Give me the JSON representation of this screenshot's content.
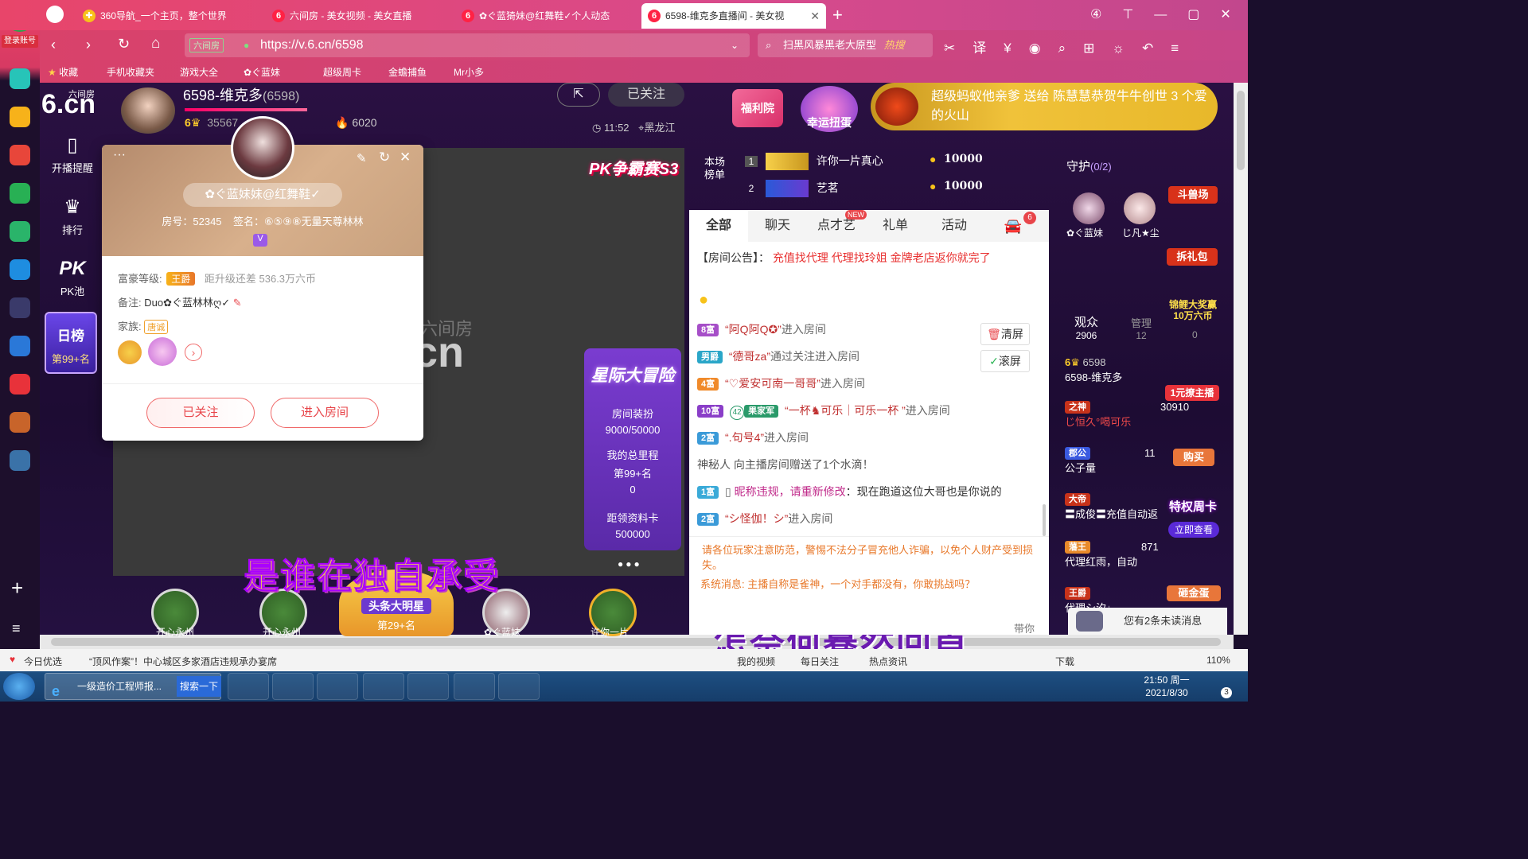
{
  "browser": {
    "login_label": "登录账号",
    "tabs": [
      {
        "label": "360导航_一个主页，整个世界"
      },
      {
        "label": "六间房 - 美女视频 - 美女直播"
      },
      {
        "label": "✿ぐ蓝猗妹@红舞鞋✓个人动态"
      },
      {
        "label": "6598-维克多直播间 - 美女视"
      }
    ],
    "address": "https://v.6.cn/6598",
    "address_badge": "六间房",
    "search_placeholder": "扫黑风暴黑老大原型",
    "search_hot": "热搜",
    "bookmarks": [
      "收藏",
      "手机收藏夹",
      "游戏大全",
      "✿ぐ蓝妹",
      "超级周卡",
      "金蟾捕鱼",
      "Mr小多"
    ]
  },
  "sidebar": {
    "items": [
      "开播提醒",
      "排行",
      "PK池"
    ],
    "day_rank": "日榜",
    "day_rank_pos": "第99+名"
  },
  "header": {
    "logo": "6.cn",
    "logo_sub": "六间房",
    "host_name": "6598-维克多",
    "host_id": "(6598)",
    "host_level": "6",
    "fans_count": "35567",
    "fire_count": "6020",
    "follow_label": "已关注",
    "time": "11:52",
    "location": "黑龙江",
    "welfare": "福利院",
    "lucky": "幸运扭蛋",
    "banner_text": "超级蚂蚁他亲爹 送给 陈慧慧恭贺牛牛创世 3 个爱的火山"
  },
  "popup": {
    "name": "✿ぐ蓝妹妹@红舞鞋✓",
    "room_label": "房号：52345",
    "sign_label": "签名：⑥⑤⑨⑧无量天尊林林",
    "wealth_label": "富豪等级:",
    "wealth_badge": "王爵",
    "wealth_next": "距升级还差 536.3万六币",
    "remark_label": "备注:",
    "remark_value": "Duo✿ぐ蓝林林ღ✓",
    "family_label": "家族:",
    "family_badge": "唐诚",
    "followed_button": "已关注",
    "enter_button": "进入房间"
  },
  "video": {
    "pk_title": "PK争霸赛S3",
    "subtitle_left": "是谁在独自承受",
    "subtitle_right": "怎奈何蓦然回首",
    "watermark": "六间房",
    "watermark_2": "cn"
  },
  "pk_panel": {
    "title": "星际大冒险",
    "decor_label": "房间装扮",
    "decor_value": "9000/50000",
    "mileage_label": "我的总里程",
    "mileage_rank": "第99+名",
    "mileage_value": "0",
    "card_label": "距领资料卡",
    "card_value": "500000"
  },
  "gifts": {
    "names": [
      "开心永州",
      "开心永州",
      "✿ぐ蓝妹",
      "许你一片"
    ],
    "star_title": "头条大明星",
    "star_rank": "第29+名"
  },
  "rank": {
    "label": "本场榜单",
    "rows": [
      {
        "pos": "1",
        "name": "许你一片真心",
        "coins": "10000"
      },
      {
        "pos": "2",
        "name": "艺茗",
        "coins": "10000"
      }
    ]
  },
  "chat": {
    "tabs": [
      "全部",
      "聊天",
      "点才艺",
      "礼单",
      "活动"
    ],
    "tab_new": "NEW",
    "car_count": "6",
    "notice_label": "【房间公告】：",
    "notice_text": "充值找代理 代理找玲姐 金牌老店返你就完了",
    "clear_btn": "清屏",
    "scroll_btn": "滚屏",
    "messages": [
      {
        "badge": "8富",
        "color": "#a64ec8",
        "text_user": "“阿Q阿Q✪”",
        "text": "进入房间"
      },
      {
        "badge": "男爵",
        "color": "#2aa6c8",
        "text_user": "“德哥za”",
        "text": "通过关注进入房间"
      },
      {
        "badge": "4富",
        "color": "#f08a2a",
        "text_user": "“♡爱安可南一哥哥”",
        "text": "进入房间"
      },
      {
        "badge": "10富",
        "color": "#8a3ec8",
        "text_user": "“一杯♞可乐｜可乐一杯 ”",
        "text": "进入房间"
      },
      {
        "badge": "2富",
        "color": "#3a9ad8",
        "text_user": "“.句号4”",
        "text": "进入房间"
      },
      {
        "badge": "",
        "color": "",
        "text_user": "",
        "text": "神秘人 向主播房间赠送了1个水滴！"
      },
      {
        "badge": "1富",
        "color": "#3aaad8",
        "text_user": "昵称违规，请重新修改",
        "text": "：现在跑道这位大哥也是你说的"
      },
      {
        "badge": "2富",
        "color": "#3a9ad8",
        "text_user": "“シ怪伽！シ”",
        "text": "进入房间"
      }
    ],
    "family_badge": "果家军",
    "family_level": "42",
    "warning": "请各位玩家注意防范，警惕不法分子冒充他人诈骗，以免个人财产受到损失。",
    "system": "系统消息: 主播自称是雀神，一个对手都没有，你敢挑战吗？",
    "bottom_hint": "带你"
  },
  "guard": {
    "title": "守护",
    "count": "(0/2)",
    "members": [
      "✿ぐ蓝妹",
      "じ凡★尘"
    ],
    "audience_label": "观众",
    "audience_count": "2906",
    "admin_label": "管理",
    "admin_count": "12",
    "third_count": "0",
    "users": [
      {
        "level": "6",
        "name": "6598-维克多",
        "extra": "6598"
      },
      {
        "level": "之神",
        "name": "じ恒久°喝可乐",
        "extra": "30910"
      },
      {
        "level": "郡公",
        "name": "公子量",
        "extra": "11"
      },
      {
        "level": "大帝",
        "name": "〓成俊〓充值自动返",
        "extra": ""
      },
      {
        "level": "藩王",
        "name": "代理红雨，自动",
        "extra": "871"
      },
      {
        "level": "王爵",
        "name": "代理シ汐↓",
        "extra": ""
      }
    ],
    "promos": [
      "斗兽场",
      "拆礼包",
      "锦鲤大奖赢10万六币",
      "1元撩主播",
      "购买",
      "特权周卡",
      "立即查看",
      "砸金蛋"
    ],
    "unread": "您有2条未读消息"
  },
  "statusbar": {
    "left": "今日优选",
    "news": "“顶风作案”！中心城区多家酒店违规承办宴席",
    "items": [
      "我的视频",
      "每日关注",
      "热点资讯",
      "下载"
    ],
    "zoom": "110%"
  },
  "taskbar": {
    "task1": "一级造价工程师报...",
    "task1_btn": "搜索一下",
    "time": "21:50 周一",
    "date": "2021/8/30",
    "notif": "3"
  },
  "colors": {
    "brand_pink": "#e8456a",
    "accent_red": "#e8454a",
    "purple_bg": "#1d0c33"
  }
}
